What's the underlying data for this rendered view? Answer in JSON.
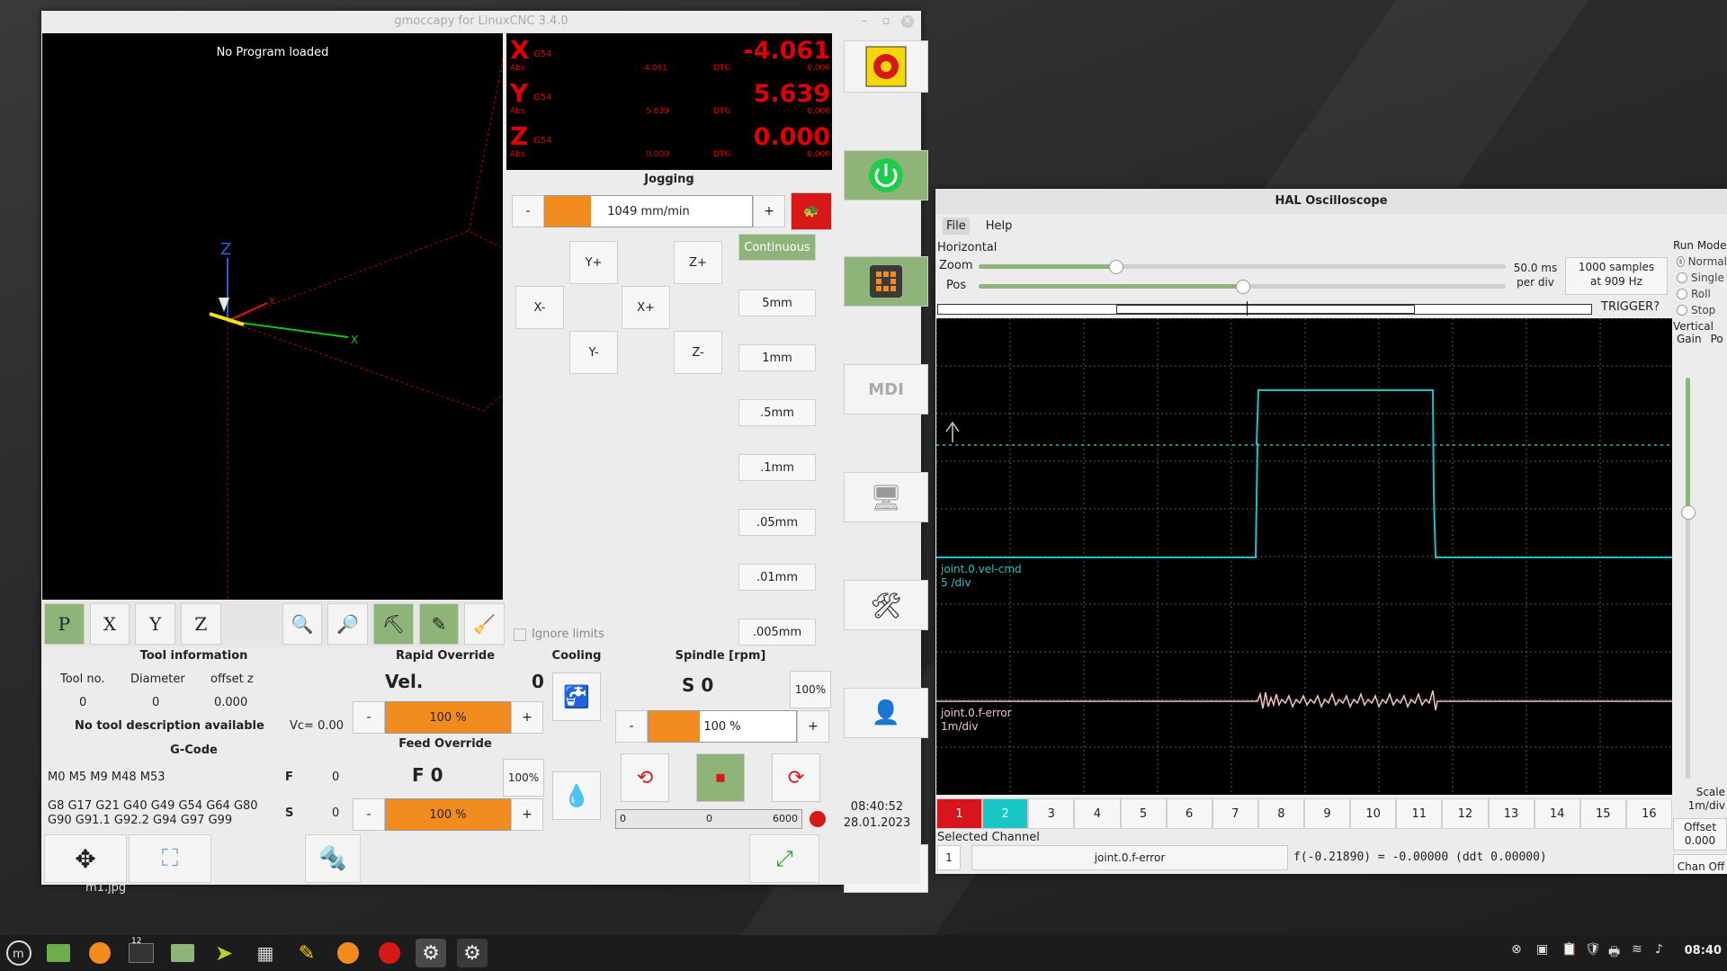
{
  "gmoccapy": {
    "title": "gmoccapy for LinuxCNC  3.4.0",
    "preview_message": "No Program loaded",
    "axis_labels": {
      "x": "X",
      "y": "Y",
      "z": "Z"
    },
    "dro": [
      {
        "axis": "X",
        "system": "G54",
        "value": "-4.061",
        "abs_label": "Abs",
        "abs": "-4.061",
        "dtg_label": "DTG",
        "dtg": "0.000"
      },
      {
        "axis": "Y",
        "system": "G54",
        "value": "5.639",
        "abs_label": "Abs",
        "abs": "5.639",
        "dtg_label": "DTG",
        "dtg": "0.000"
      },
      {
        "axis": "Z",
        "system": "G54",
        "value": "0.000",
        "abs_label": "Abs",
        "abs": "0.000",
        "dtg_label": "DTG",
        "dtg": "0.000"
      }
    ],
    "jogging": {
      "title": "Jogging",
      "minus": "-",
      "plus": "+",
      "speed_label": "1049 mm/min",
      "speed_fraction": 0.22,
      "buttons": {
        "yplus": "Y+",
        "zplus": "Z+",
        "xminus": "X-",
        "xplus": "X+",
        "yminus": "Y-",
        "zminus": "Z-"
      },
      "increments": [
        "Continuous",
        "5mm",
        "1mm",
        ".5mm",
        ".1mm",
        ".05mm",
        ".01mm",
        ".005mm"
      ],
      "ignore_limits": "Ignore limits"
    },
    "tool_info": {
      "title": "Tool information",
      "headers": [
        "Tool no.",
        "Diameter",
        "offset z"
      ],
      "values": [
        "0",
        "0",
        "0.000"
      ],
      "description": "No tool description available",
      "vc": "Vc= 0.00"
    },
    "gcode": {
      "title": "G-Code",
      "mcodes": "M0 M5 M9 M48 M53",
      "gcodes_line1": "G8 G17 G21 G40 G49 G54 G64 G80",
      "gcodes_line2": "G90 G91.1 G92.2 G94 G97 G99",
      "f_label": "F",
      "f_value": "0",
      "s_label": "S",
      "s_value": "0"
    },
    "rapid_override": {
      "title": "Rapid Override",
      "vel_label": "Vel.",
      "vel_value": "0",
      "percent": "100 %",
      "fraction": 1.0
    },
    "feed_override": {
      "title": "Feed Override",
      "label": "F  0",
      "percent": "100 %",
      "fraction": 1.0,
      "reset_label": "100%"
    },
    "cooling": {
      "title": "Cooling"
    },
    "spindle": {
      "title": "Spindle [rpm]",
      "label": "S  0",
      "reset_label": "100%",
      "percent": "100 %",
      "fraction": 0.35,
      "gauge_min": "0",
      "gauge_value": "0",
      "gauge_max": "6000"
    },
    "clock": {
      "time": "08:40:52",
      "date": "28.01.2023"
    },
    "desktop_label": "m1.jpg"
  },
  "halscope": {
    "title": "HAL Oscilloscope",
    "menu": [
      "File",
      "Help"
    ],
    "horizontal": "Horizontal",
    "zoom_label": "Zoom",
    "pos_label": "Pos",
    "zoom_fraction": 0.26,
    "pos_fraction": 0.5,
    "per_div": "50.0 ms",
    "per_div_sub": "per div",
    "samples": "1000 samples",
    "samples_sub": "at 909 Hz",
    "trigger": "TRIGGER?",
    "run_mode_title": "Run Mode",
    "run_modes": [
      "Normal",
      "Single",
      "Roll",
      "Stop"
    ],
    "vertical": "Vertical",
    "gain": "Gain",
    "pos_short": "Po",
    "scale_label": "Scale",
    "scale_value": "1m/div",
    "offset_label": "Offset",
    "offset_value": "0.000",
    "chan_off": "Chan Off",
    "traces": [
      {
        "name": "joint.0.vel-cmd",
        "scale": "5 /div",
        "color": "#19c4c4"
      },
      {
        "name": "joint.0.f-error",
        "scale": "1m/div",
        "color": "#f2c3c3"
      }
    ],
    "channels": [
      "1",
      "2",
      "3",
      "4",
      "5",
      "6",
      "7",
      "8",
      "9",
      "10",
      "11",
      "12",
      "13",
      "14",
      "15",
      "16"
    ],
    "selected_channel_label": "Selected Channel",
    "selected_channel_num": "1",
    "selected_channel_name": "joint.0.f-error",
    "readout": "f(-0.21890) = -0.00000 (ddt  0.00000)"
  },
  "taskbar": {
    "clock": "08:40",
    "badge": "12"
  }
}
